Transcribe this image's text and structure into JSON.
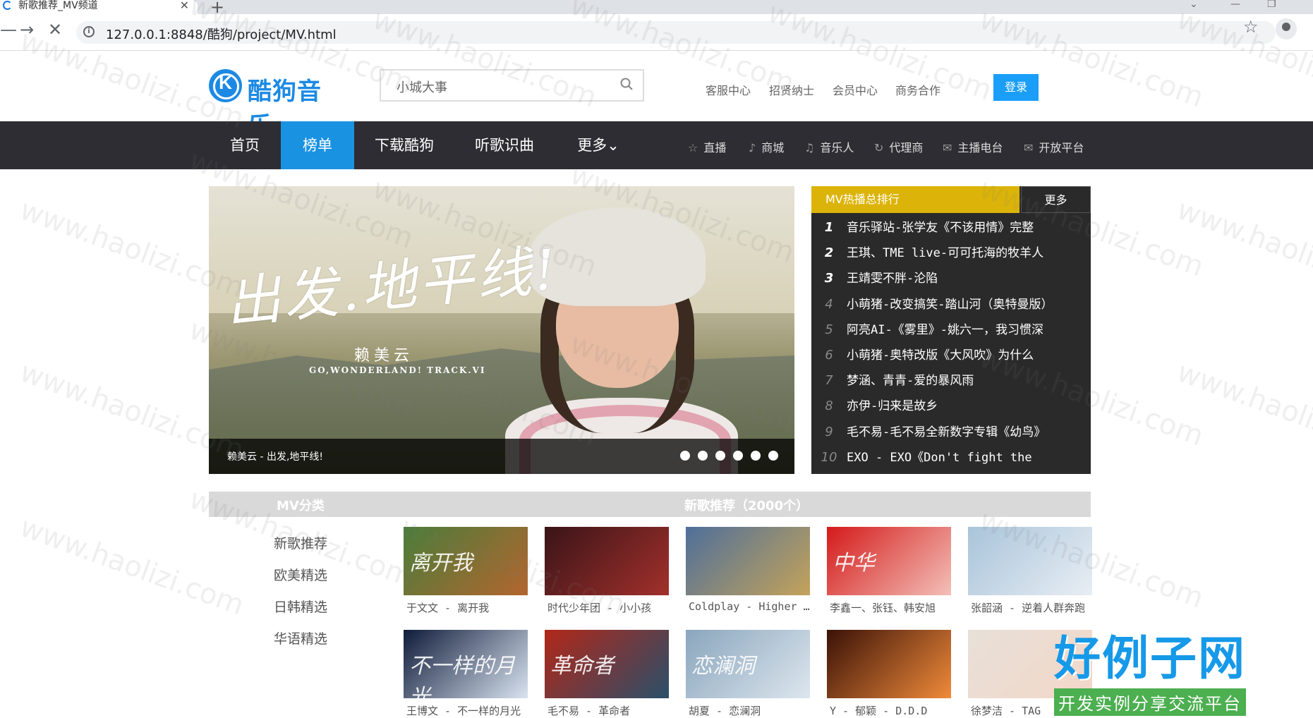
{
  "browser": {
    "tab_title": "新歌推荐_MV频道",
    "url": "127.0.0.1:8848/酷狗/project/MV.html"
  },
  "header": {
    "logo_text": "酷狗音乐",
    "logo_letter": "K",
    "search_placeholder": "小城大事",
    "links": [
      "客服中心",
      "招贤纳士",
      "会员中心",
      "商务合作"
    ],
    "login_label": "登录"
  },
  "nav": {
    "items": [
      "首页",
      "榜单",
      "下载酷狗",
      "听歌识曲",
      "更多"
    ],
    "active_index": 1,
    "more_suffix": "⌄",
    "subs": [
      {
        "icon": "star-icon",
        "glyph": "☆",
        "label": "直播"
      },
      {
        "icon": "music-note-icon",
        "glyph": "♪",
        "label": "商城"
      },
      {
        "icon": "headphones-icon",
        "glyph": "♫",
        "label": "音乐人"
      },
      {
        "icon": "refresh-icon",
        "glyph": "↻",
        "label": "代理商"
      },
      {
        "icon": "mail-icon",
        "glyph": "✉",
        "label": "主播电台"
      },
      {
        "icon": "mail-icon",
        "glyph": "✉",
        "label": "开放平台"
      }
    ]
  },
  "banner": {
    "title": "出发.地平线!",
    "singer": "赖美云",
    "subtitle": "GO,WONDERLAND! TRACK.VI",
    "caption": "赖美云 - 出发,地平线!",
    "dot_count": 6
  },
  "ranking": {
    "title": "MV热播总排行",
    "more_label": "更多",
    "items": [
      {
        "n": "1",
        "title": "音乐驿站-张学友《不该用情》完整"
      },
      {
        "n": "2",
        "title": "王琪、TME live-可可托海的牧羊人"
      },
      {
        "n": "3",
        "title": "王靖雯不胖-沦陷"
      },
      {
        "n": "4",
        "title": "小萌猪-改变搞笑-踏山河（奥特曼版）"
      },
      {
        "n": "5",
        "title": "阿亮AI-《雾里》-姚六一，我习惯深"
      },
      {
        "n": "6",
        "title": "小萌猪-奥特改版《大风吹》为什么"
      },
      {
        "n": "7",
        "title": "梦涵、青青-爱的暴风雨"
      },
      {
        "n": "8",
        "title": "亦伊-归来是故乡"
      },
      {
        "n": "9",
        "title": "毛不易-毛不易全新数字专辑《幼鸟》"
      },
      {
        "n": "10",
        "title": "EXO - EXO《Don't fight the"
      }
    ]
  },
  "section": {
    "left_title": "MV分类",
    "right_title": "新歌推荐（2000个）",
    "categories": [
      "新歌推荐",
      "欧美精选",
      "日韩精选",
      "华语精选"
    ]
  },
  "cards_row1": [
    {
      "caption": "于文文 - 离开我",
      "thumb_text": "离开我",
      "color1": "#4a7d3a",
      "color2": "#b3652f"
    },
    {
      "caption": "时代少年团 - 小小孩",
      "thumb_text": "",
      "color1": "#3a1418",
      "color2": "#a2302b"
    },
    {
      "caption": "Coldplay - Higher Power",
      "thumb_text": "",
      "color1": "#4e6f9a",
      "color2": "#c4a35a"
    },
    {
      "caption": "李鑫一、张钰、韩安旭",
      "thumb_text": "中华",
      "color1": "#d41a1a",
      "color2": "#f3c0b8"
    },
    {
      "caption": "张韶涵 - 逆着人群奔跑",
      "thumb_text": "",
      "color1": "#a9c4da",
      "color2": "#e8eef4"
    }
  ],
  "cards_row2": [
    {
      "caption": "王博文 - 不一样的月光",
      "thumb_text": "不一样的月光",
      "color1": "#0f1c3a",
      "color2": "#d9e3f0"
    },
    {
      "caption": "毛不易 - 革命者",
      "thumb_text": "革命者",
      "color1": "#b22718",
      "color2": "#2a4f6a"
    },
    {
      "caption": "胡夏 - 恋澜洞",
      "thumb_text": "恋澜洞",
      "color1": "#8aa6bd",
      "color2": "#dde6ee"
    },
    {
      "caption": "Y - 郁颖 - D.D.D",
      "thumb_text": "",
      "color1": "#3a1208",
      "color2": "#f08a3a"
    },
    {
      "caption": "徐梦洁 - TAG",
      "thumb_text": "",
      "color1": "#e7e0d8",
      "color2": "#f4d7c8"
    }
  ],
  "corner_logo": {
    "big": "好例子网",
    "small": "开发实例分享交流平台"
  },
  "watermark": "www.haolizi.com"
}
